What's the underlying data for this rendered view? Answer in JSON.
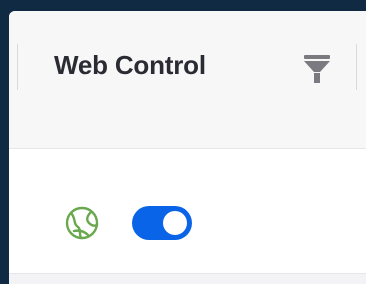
{
  "table": {
    "column_title": "Web Control",
    "filter_icon": "filter-icon"
  },
  "row": {
    "globe_icon": "globe-icon",
    "toggle": {
      "state": "on"
    }
  },
  "colors": {
    "background_dark": "#0f2a42",
    "toggle_on": "#0a64e8",
    "globe_green": "#6aa84f",
    "filter_gray": "#7a7a80",
    "title_text": "#2b2b33"
  }
}
